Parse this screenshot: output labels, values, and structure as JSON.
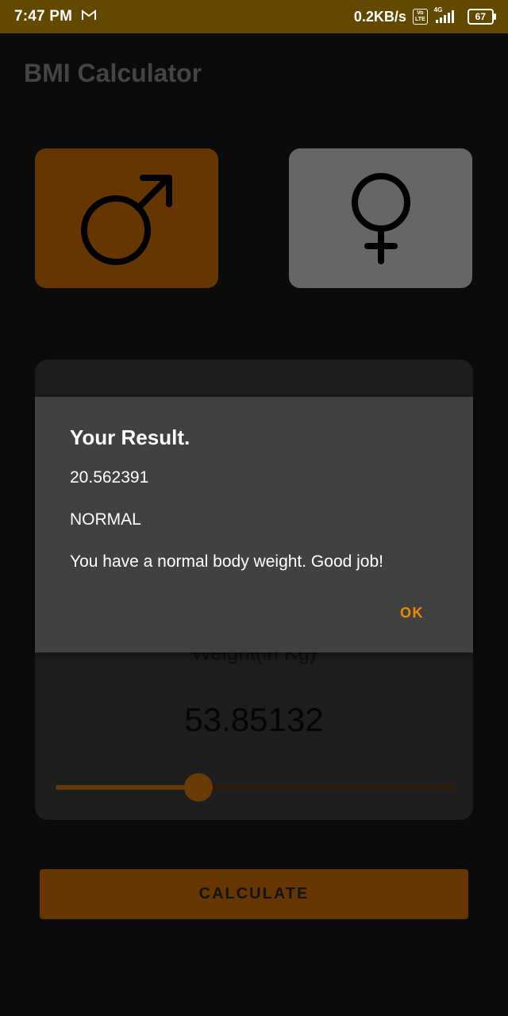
{
  "status_bar": {
    "time": "7:47 PM",
    "mail_glyph": "M",
    "speed": "0.2KB/s",
    "volte": "Vo\nLTE",
    "network": "4G",
    "battery": "67",
    "color": "#634800"
  },
  "app": {
    "title": "BMI Calculator",
    "selected_gender": "male",
    "gender_cards": [
      {
        "id": "male",
        "icon": "male-symbol-icon"
      },
      {
        "id": "female",
        "icon": "female-symbol-icon"
      }
    ],
    "weight_card": {
      "label": "Weight(in Kg)",
      "value": "53.85132",
      "slider_fraction": 0.36
    },
    "calculate_label": "CALCULATE",
    "accent_color": "#663600"
  },
  "dialog": {
    "title": "Your Result.",
    "bmi": "20.562391",
    "category": "NORMAL",
    "message": "You have a normal body weight. Good job!",
    "ok_label": "OK",
    "ok_color": "#f08a00"
  }
}
